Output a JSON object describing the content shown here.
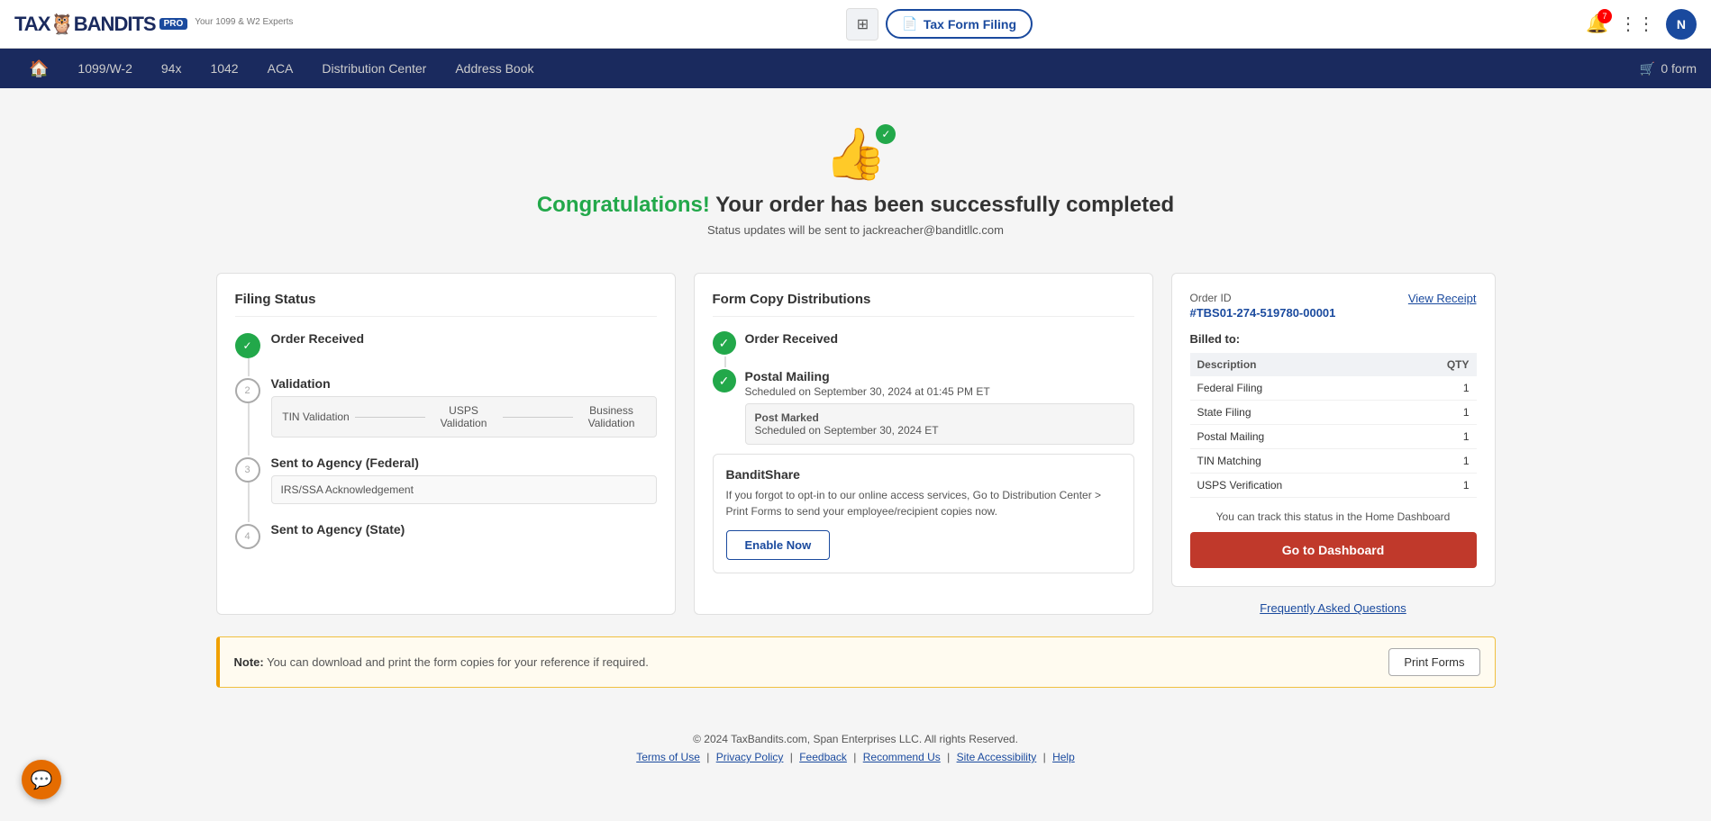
{
  "header": {
    "logo_text": "TAX🦉BANDITS",
    "logo_sub": "Your 1099 & W2 Experts",
    "pro_badge": "PRO",
    "grid_icon": "⊞",
    "tax_form_label": "Tax Form Filing",
    "notif_count": "7",
    "apps_icon": "⋮⋮⋮",
    "avatar_label": "N",
    "cart_label": "0 form"
  },
  "nav": {
    "home_icon": "🏠",
    "items": [
      {
        "id": "1099w2",
        "label": "1099/W-2"
      },
      {
        "id": "94x",
        "label": "94x"
      },
      {
        "id": "1042",
        "label": "1042"
      },
      {
        "id": "aca",
        "label": "ACA"
      },
      {
        "id": "distribution",
        "label": "Distribution Center"
      },
      {
        "id": "address",
        "label": "Address Book"
      }
    ]
  },
  "congrats": {
    "icon": "👍",
    "congrats_word": "Congratulations!",
    "title_rest": " Your order has been successfully completed",
    "subtitle": "Status updates will be sent to jackreacher@banditllc.com"
  },
  "filing_status": {
    "title": "Filing Status",
    "steps": [
      {
        "id": "order_received",
        "label": "Order Received",
        "status": "completed",
        "number": ""
      },
      {
        "id": "validation",
        "label": "Validation",
        "status": "pending",
        "number": "2",
        "sub_items": [
          "TIN Validation",
          "USPS Validation",
          "Business Validation"
        ]
      },
      {
        "id": "sent_federal",
        "label": "Sent to Agency (Federal)",
        "status": "pending",
        "number": "3",
        "sub_items": [
          "IRS/SSA Acknowledgement"
        ]
      },
      {
        "id": "sent_state",
        "label": "Sent to Agency (State)",
        "status": "pending",
        "number": "4"
      }
    ]
  },
  "form_copy": {
    "title": "Form Copy Distributions",
    "steps": [
      {
        "id": "order_received",
        "label": "Order Received",
        "status": "completed"
      },
      {
        "id": "postal_mailing",
        "label": "Postal Mailing",
        "status": "completed",
        "sub": "Scheduled on September 30, 2024 at 01:45 PM ET",
        "postmark_label": "Post Marked",
        "postmark_date": "Scheduled on September 30, 2024 ET"
      }
    ],
    "banditshare": {
      "title": "BanditShare",
      "text": "If you forgot to opt-in to our online access services, Go to Distribution Center > Print Forms to send your employee/recipient copies now.",
      "enable_btn": "Enable Now"
    }
  },
  "order_panel": {
    "order_id_label": "Order ID",
    "order_id": "#TBS01-274-519780-00001",
    "view_receipt": "View Receipt",
    "billed_label": "Billed to:",
    "table_headers": [
      "Description",
      "QTY"
    ],
    "table_rows": [
      {
        "desc": "Federal Filing",
        "qty": "1"
      },
      {
        "desc": "State Filing",
        "qty": "1"
      },
      {
        "desc": "Postal Mailing",
        "qty": "1"
      },
      {
        "desc": "TIN Matching",
        "qty": "1"
      },
      {
        "desc": "USPS Verification",
        "qty": "1"
      }
    ],
    "track_text": "You can track this status in the Home Dashboard",
    "dashboard_btn": "Go to Dashboard",
    "faq_link": "Frequently Asked Questions"
  },
  "note_bar": {
    "note_label": "Note:",
    "note_text": " You can download and print the form copies for your reference if required.",
    "print_btn": "Print Forms"
  },
  "footer": {
    "copyright": "© 2024 TaxBandits.com, Span Enterprises LLC. All rights Reserved.",
    "links": [
      {
        "id": "terms",
        "label": "Terms of Use"
      },
      {
        "id": "privacy",
        "label": "Privacy Policy"
      },
      {
        "id": "feedback",
        "label": "Feedback"
      },
      {
        "id": "recommend",
        "label": "Recommend Us"
      },
      {
        "id": "accessibility",
        "label": "Site Accessibility"
      },
      {
        "id": "help",
        "label": "Help"
      }
    ]
  },
  "colors": {
    "accent_blue": "#1a4a9e",
    "nav_bg": "#1a2a5e",
    "green": "#22a84a",
    "red_btn": "#c0392b",
    "orange": "#e56c00"
  }
}
